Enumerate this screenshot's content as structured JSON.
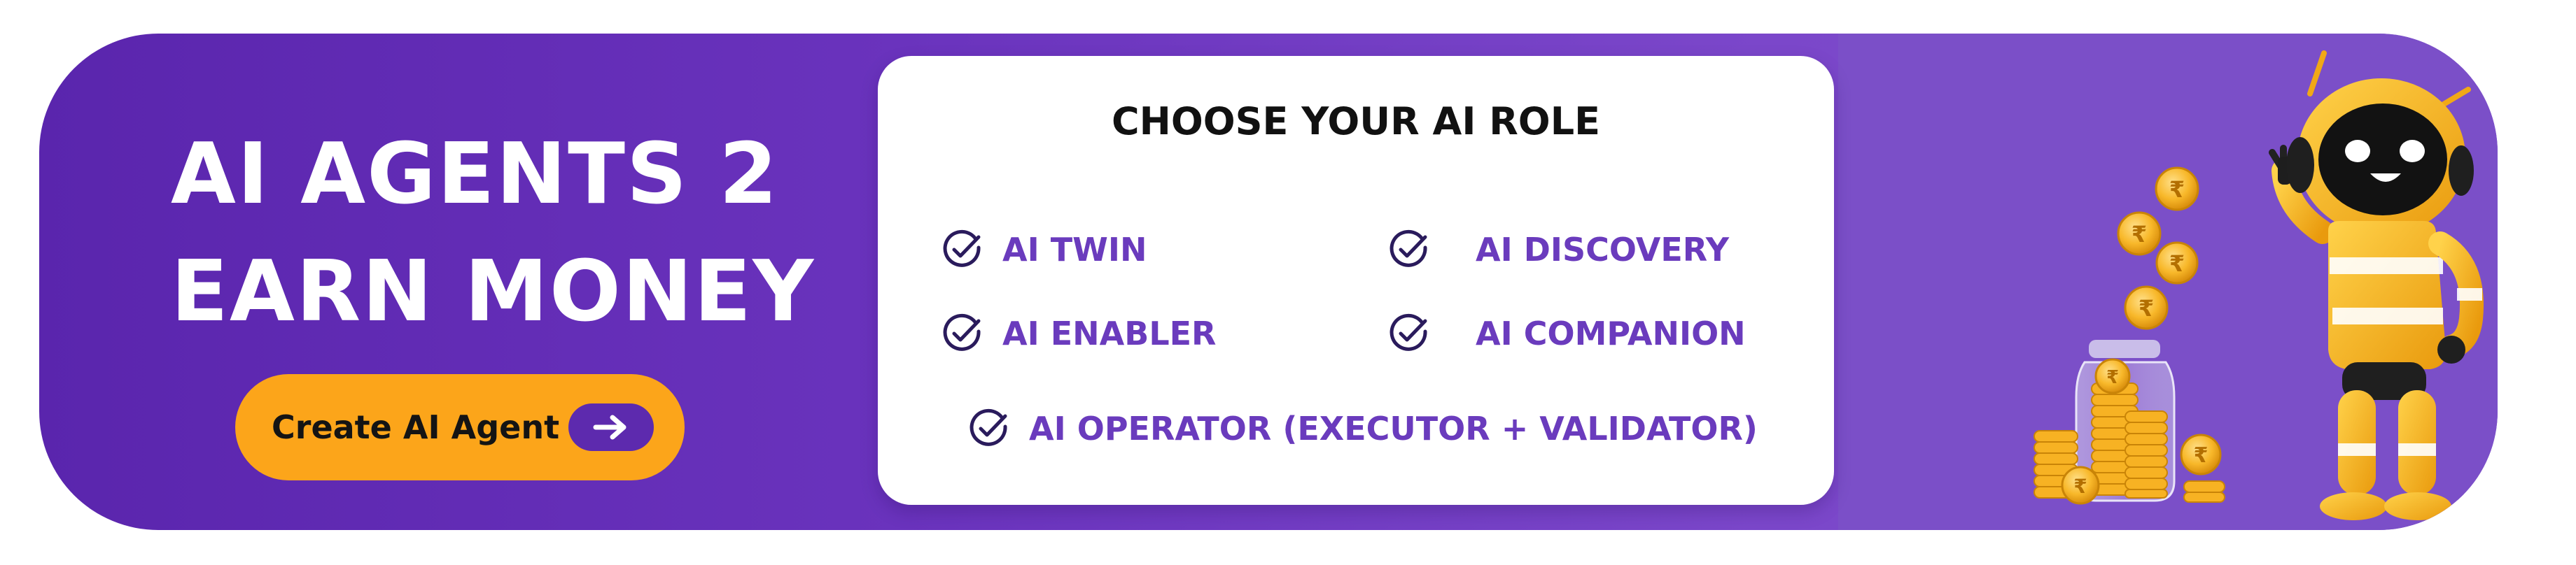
{
  "banner": {
    "headline_line1": "AI AGENTS 2",
    "headline_line2": "EARN MONEY",
    "cta_label": "Create AI Agent"
  },
  "card": {
    "title": "CHOOSE YOUR AI ROLE",
    "roles": [
      {
        "label": "AI TWIN"
      },
      {
        "label": "AI DISCOVERY"
      },
      {
        "label": "AI ENABLER"
      },
      {
        "label": "AI COMPANION"
      },
      {
        "label": "AI OPERATOR (EXECUTOR + VALIDATOR)"
      }
    ]
  },
  "illustration": {
    "coin_symbol": "₹"
  },
  "icons": {
    "role_check": "check-circle-icon",
    "cta_arrow": "arrow-right-icon",
    "robot": "robot-mascot-icon",
    "coin": "rupee-coin-icon",
    "jar": "coin-jar-icon"
  },
  "colors": {
    "banner_purple": "#6a33bd",
    "cta_orange": "#fca51a",
    "role_text": "#6a3bbd",
    "robot_yellow": "#f7b21a"
  }
}
